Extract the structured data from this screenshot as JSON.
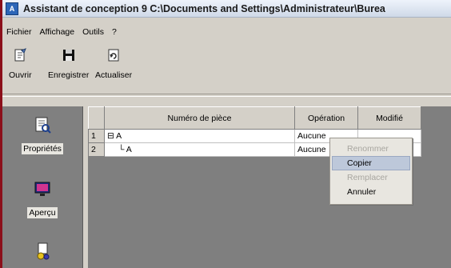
{
  "window": {
    "title": "Assistant de conception 9 C:\\Documents and Settings\\Administrateur\\Burea"
  },
  "menu": [
    "Fichier",
    "Affichage",
    "Outils",
    "?"
  ],
  "toolbar": {
    "open_label": "Ouvrir",
    "save_label": "Enregistrer",
    "refresh_label": "Actualiser"
  },
  "sidebar": {
    "properties_label": "Propriétés",
    "preview_label": "Aperçu"
  },
  "table": {
    "headers": {
      "part": "Numéro de pièce",
      "operation": "Opération",
      "modified": "Modifié"
    },
    "rows": [
      {
        "num": "1",
        "expander": "⊟",
        "part": "A",
        "operation": "Aucune",
        "modified": ""
      },
      {
        "num": "2",
        "expander": "└",
        "part": "A",
        "operation": "Aucune",
        "modified": ""
      }
    ]
  },
  "context_menu": {
    "items": [
      "Renommer",
      "Copier",
      "Remplacer",
      "Annuler"
    ],
    "disabled": [
      "Renommer",
      "Remplacer"
    ],
    "highlighted": "Copier"
  },
  "colors": {
    "accent_border": "#8b0f1a",
    "sidebar_bg": "#808080",
    "highlight": "#bdc8da"
  }
}
